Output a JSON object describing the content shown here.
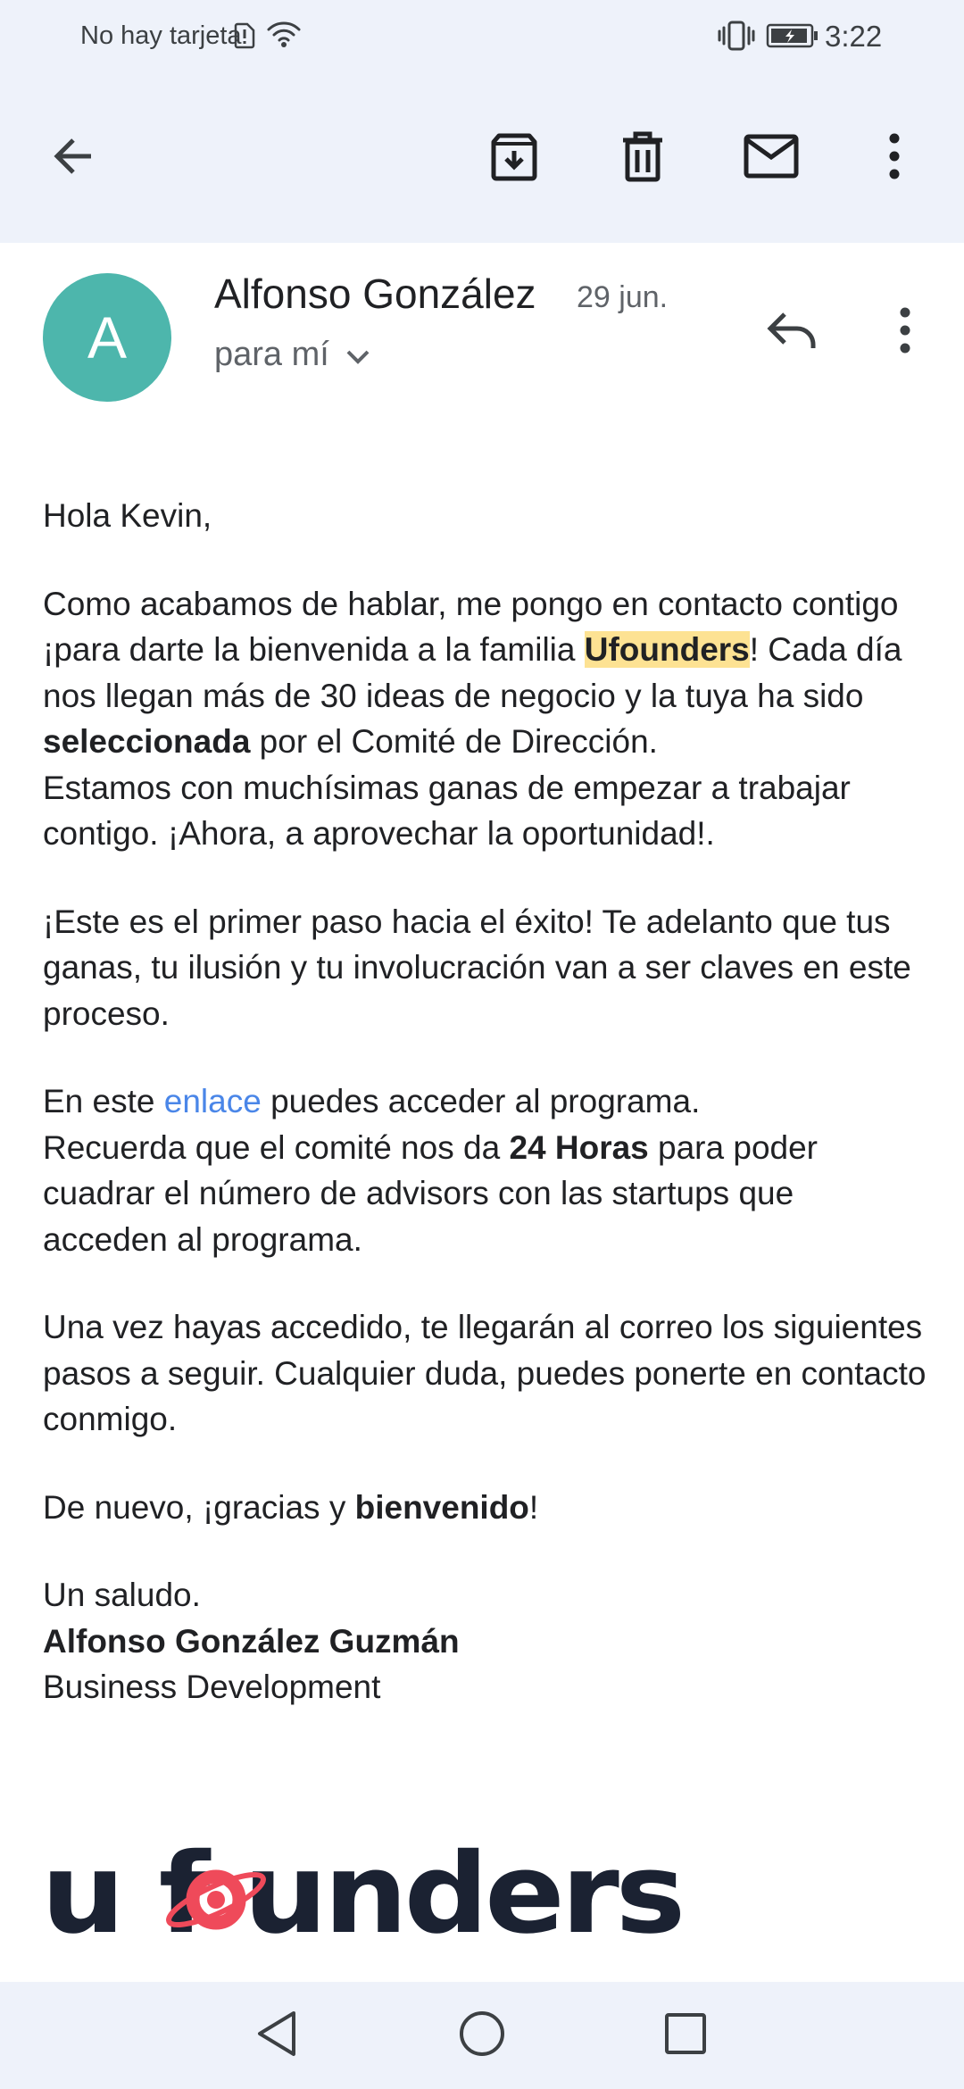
{
  "status_bar": {
    "carrier": "No hay tarjeta",
    "time": "3:22"
  },
  "toolbar": {
    "icons": [
      "back-arrow-icon",
      "archive-icon",
      "trash-icon",
      "mail-icon",
      "more-vert-icon"
    ]
  },
  "sender": {
    "avatar_initial": "A",
    "avatar_color": "#4db6ac",
    "name": "Alfonso González",
    "date": "29 jun.",
    "recipient": "para mí"
  },
  "body": {
    "greeting": "Hola Kevin,",
    "p1_a": "Como acabamos de hablar, me pongo en contacto contigo ¡para darte la bienvenida a la familia ",
    "p1_highlight": "Ufounders",
    "p1_b": "! Cada día nos llegan más de 30 ideas de negocio y la tuya ha sido ",
    "p1_bold": "seleccionada",
    "p1_c": " por el Comité de Dirección.",
    "p1_d": "Estamos con muchísimas ganas de empezar a trabajar contigo. ¡Ahora, a aprovechar la oportunidad!.",
    "p2": "¡Este es el primer paso hacia el éxito! Te adelanto que tus ganas, tu ilusión y tu involucración van a ser claves en este proceso.",
    "p3_a": "En este ",
    "p3_link": "enlace",
    "p3_b": " puedes acceder al programa.",
    "p3_c": "Recuerda que el comité nos da ",
    "p3_bold": "24 Horas",
    "p3_d": " para poder cuadrar el número de advisors con las startups que acceden al programa.",
    "p4": "Una vez hayas accedido, te llegarán al correo los siguientes pasos a seguir. Cualquier duda, puedes ponerte en contacto conmigo.",
    "p5_a": "De nuevo, ¡gracias y ",
    "p5_bold": "bienvenido",
    "p5_b": "!",
    "sign_off": "Un saludo.",
    "signature_name": "Alfonso González Guzmán",
    "signature_title": "Business Development"
  },
  "logo": {
    "text": "ufounders",
    "primary_color": "#1b2232",
    "accent_color": "#ef4a5a"
  },
  "nav_bar": {
    "icons": [
      "nav-back-icon",
      "nav-home-icon",
      "nav-recents-icon"
    ]
  }
}
